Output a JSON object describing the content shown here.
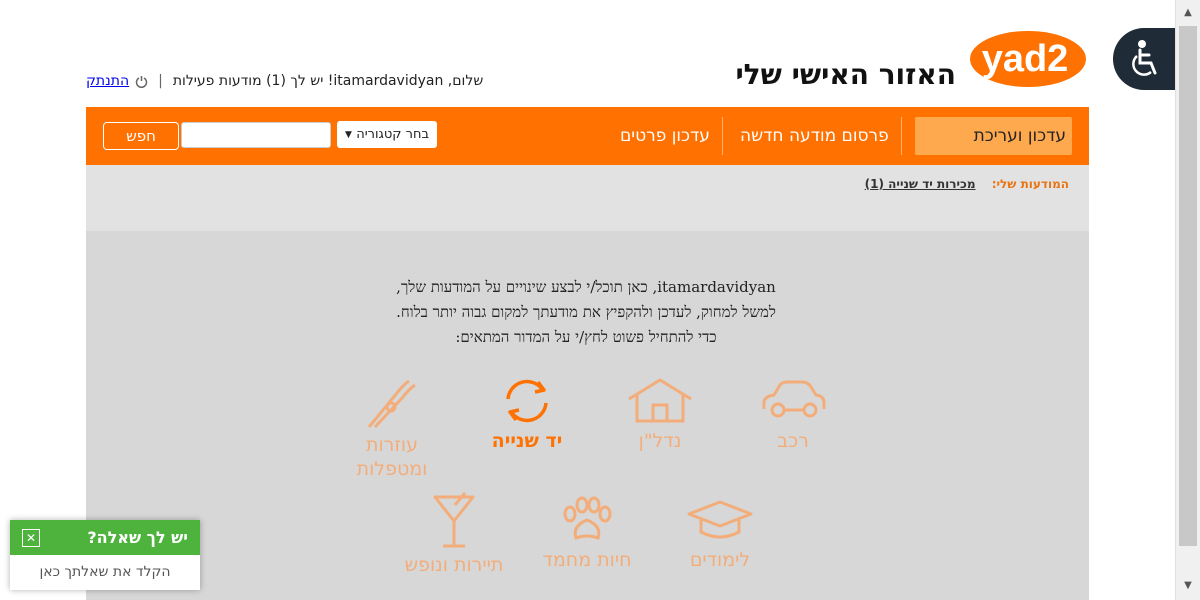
{
  "header": {
    "logo_text": "yad2",
    "title": "האזור האישי שלי",
    "greeting": "שלום, itamardavidyan! יש לך (1) מודעות פעילות",
    "logout": "התנתק"
  },
  "nav": {
    "tabs": [
      {
        "label": "עדכון ועריכת מודעות",
        "active": true
      },
      {
        "label": "פרסום מודעה חדשה",
        "active": false
      },
      {
        "label": "עדכון פרטים",
        "active": false
      }
    ],
    "category_select": "בחר קטגוריה",
    "search_value": "",
    "search_button": "חפש"
  },
  "breadcrumb": {
    "label": "המודעות שלי:",
    "link": "מכירות יד שנייה (1)"
  },
  "intro": {
    "line1": "itamardavidyan, כאן תוכל/י לבצע שינויים על המודעות שלך,",
    "line2": "למשל למחוק, לעדכן ולהקפיץ את מודעתך למקום גבוה יותר בלוח.",
    "line3": "כדי להתחיל פשוט לחץ/י על המדור המתאים:"
  },
  "categories": [
    {
      "label": "רכב",
      "icon": "car-icon",
      "selected": false
    },
    {
      "label": "נדל\"ן",
      "icon": "house-icon",
      "selected": false
    },
    {
      "label": "יד שנייה",
      "icon": "recycle-icon",
      "selected": true
    },
    {
      "label": "עוזרות ומטפלות",
      "icon": "clothespin-icon",
      "selected": false
    },
    {
      "label": "לימודים",
      "icon": "graduation-cap-icon",
      "selected": false
    },
    {
      "label": "חיות מחמד",
      "icon": "paw-icon",
      "selected": false
    },
    {
      "label": "תיירות ונופש",
      "icon": "cocktail-icon",
      "selected": false
    }
  ],
  "chat": {
    "title": "יש לך שאלה?",
    "placeholder": "הקלד את שאלתך כאן"
  },
  "colors": {
    "brand_orange": "#ff7100",
    "active_tab": "#ffa94f",
    "chat_green": "#4db33d"
  }
}
